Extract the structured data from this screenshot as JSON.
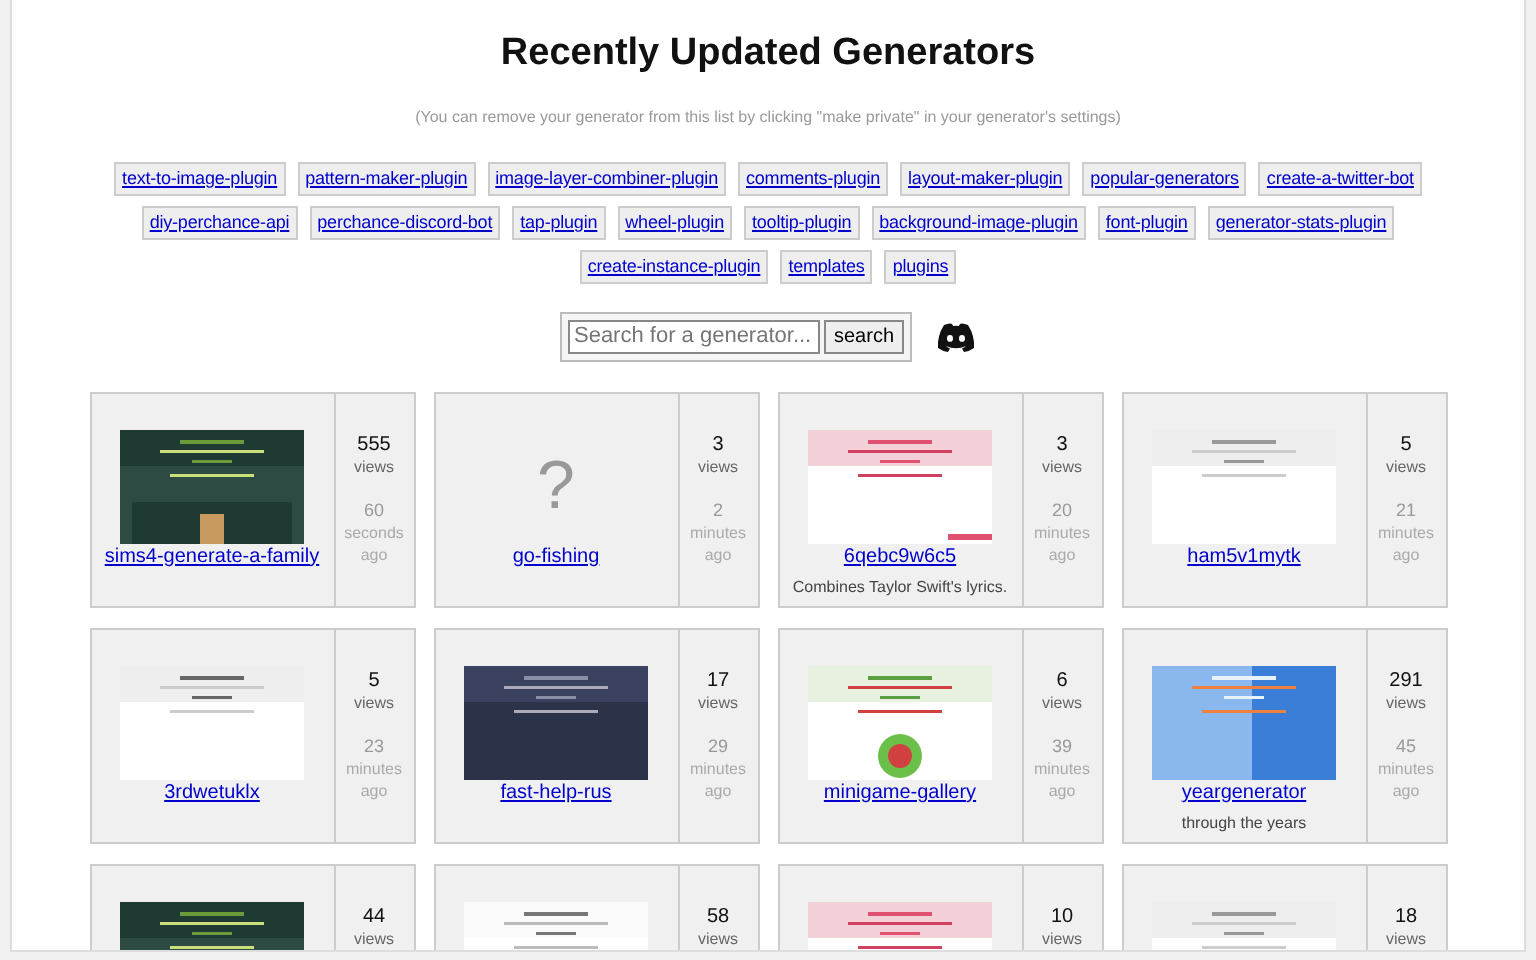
{
  "title": "Recently Updated Generators",
  "note": "(You can remove your generator from this list by clicking \"make private\" in your generator's settings)",
  "tags": [
    "text-to-image-plugin",
    "pattern-maker-plugin",
    "image-layer-combiner-plugin",
    "comments-plugin",
    "layout-maker-plugin",
    "popular-generators",
    "create-a-twitter-bot",
    "diy-perchance-api",
    "perchance-discord-bot",
    "tap-plugin",
    "wheel-plugin",
    "tooltip-plugin",
    "background-image-plugin",
    "font-plugin",
    "generator-stats-plugin",
    "create-instance-plugin",
    "templates",
    "plugins"
  ],
  "search": {
    "placeholder": "Search for a generator...",
    "button": "search"
  },
  "generators": [
    {
      "kind": "picture",
      "name": "sims4-generate-a-family",
      "views": "555",
      "views_label": "views",
      "age": [
        "60",
        "seconds",
        "ago"
      ]
    },
    {
      "kind": "no_image",
      "no_image_mark": "?",
      "name": "go-fishing",
      "views": "3",
      "views_label": "views",
      "age": [
        "2",
        "minutes",
        "ago"
      ]
    },
    {
      "kind": "picture",
      "name": "6qebc9w6c5",
      "description": "Combines Taylor Swift's lyrics.",
      "views": "3",
      "views_label": "views",
      "age": [
        "20",
        "minutes",
        "ago"
      ]
    },
    {
      "kind": "picture",
      "name": "ham5v1mytk",
      "views": "5",
      "views_label": "views",
      "age": [
        "21",
        "minutes",
        "ago"
      ]
    },
    {
      "kind": "picture",
      "name": "3rdwetuklx",
      "views": "5",
      "views_label": "views",
      "age": [
        "23",
        "minutes",
        "ago"
      ]
    },
    {
      "kind": "picture",
      "name": "fast-help-rus",
      "views": "17",
      "views_label": "views",
      "age": [
        "29",
        "minutes",
        "ago"
      ]
    },
    {
      "kind": "picture",
      "name": "minigame-gallery",
      "views": "6",
      "views_label": "views",
      "age": [
        "39",
        "minutes",
        "ago"
      ]
    },
    {
      "kind": "picture",
      "name": "yeargenerator",
      "description": "through the years",
      "views": "291",
      "views_label": "views",
      "age": [
        "45",
        "minutes",
        "ago"
      ]
    },
    {
      "kind": "picture",
      "views": "44",
      "views_label": "views"
    },
    {
      "kind": "picture",
      "views": "58",
      "views_label": "views"
    },
    {
      "kind": "picture",
      "views": "10",
      "views_label": "views"
    },
    {
      "kind": "picture",
      "views": "18",
      "views_label": "views"
    }
  ]
}
